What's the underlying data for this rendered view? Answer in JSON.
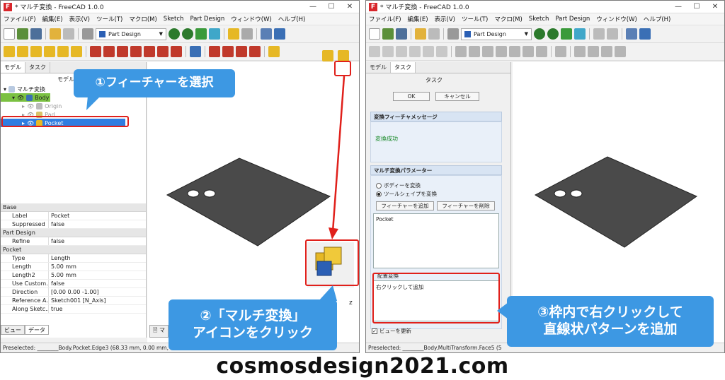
{
  "left_window": {
    "title": "* マルチ変換 - FreeCAD 1.0.0",
    "menu": [
      "ファイル(F)",
      "編集(E)",
      "表示(V)",
      "ツール(T)",
      "マクロ(M)",
      "Sketch",
      "Part Design",
      "ウィンドウ(W)",
      "ヘルプ(H)"
    ],
    "workbench": "Part Design",
    "tabs": [
      "モデル",
      "タスク"
    ],
    "tree_header": "モデル",
    "tree": [
      {
        "label": "マルチ変換",
        "level": 0
      },
      {
        "label": "Body",
        "level": 1
      },
      {
        "label": "Origin",
        "level": 2
      },
      {
        "label": "Pad",
        "level": 2
      },
      {
        "label": "Pocket",
        "level": 1
      }
    ],
    "properties": [
      {
        "group": "Base",
        "rows": [
          [
            "Label",
            "Pocket"
          ],
          [
            "Suppressed",
            "false"
          ]
        ]
      },
      {
        "group": "Part Design",
        "rows": [
          [
            "Refine",
            "false"
          ]
        ]
      },
      {
        "group": "Pocket",
        "rows": [
          [
            "Type",
            "Length"
          ],
          [
            "Length",
            "5.00 mm"
          ],
          [
            "Length2",
            "5.00 mm"
          ],
          [
            "Use Custom...",
            "false"
          ],
          [
            "Direction",
            "[0.00 0.00 -1.00]"
          ],
          [
            "Reference A...",
            "Sketch001 [N_Axis]"
          ],
          [
            "Along Sketc...",
            "true"
          ]
        ]
      }
    ],
    "bottom_tabs": [
      "ビュー",
      "データ"
    ],
    "status": "Preselected: ________Body.Pocket.Edge3 (68.33 mm, 0.00 mm,"
  },
  "right_window": {
    "title": "* マルチ変換 - FreeCAD 1.0.0",
    "menu": [
      "ファイル(F)",
      "編集(E)",
      "表示(V)",
      "ツール(T)",
      "マクロ(M)",
      "Sketch",
      "Part Design",
      "ウィンドウ(W)",
      "ヘルプ(H)"
    ],
    "workbench": "Part Design",
    "tabs": [
      "モデル",
      "タスク"
    ],
    "task_title": "タスク",
    "ok": "OK",
    "cancel": "キャンセル",
    "msg_head": "変換フィーチャメッセージ",
    "msg_body": "変換成功",
    "param_head": "マルチ変換パラメーター",
    "radio_body": "ボディーを変換",
    "radio_tool": "ツールシェイプを変換",
    "btn_add": "フィーチャーを追加",
    "btn_remove": "フィーチャーを削除",
    "feature_list": "Pocket",
    "placement_label": "配置変換",
    "placement_hint": "右クリックして追加",
    "update_view": "ビューを更新",
    "status": "Preselected: ________Body.MultiTransform.Face5 (5"
  },
  "callouts": {
    "step1": "①フィーチャーを選択",
    "step2_line1": "②「マルチ変換」",
    "step2_line2": "アイコンをクリック",
    "step3_line1": "③枠内で右クリックして",
    "step3_line2": "直線状パターンを追加"
  },
  "footer": "cosmosdesign2021.com",
  "colors": {
    "callout": "#3d98e3",
    "highlight": "#e0201b",
    "plate": "#4a4a4a"
  }
}
